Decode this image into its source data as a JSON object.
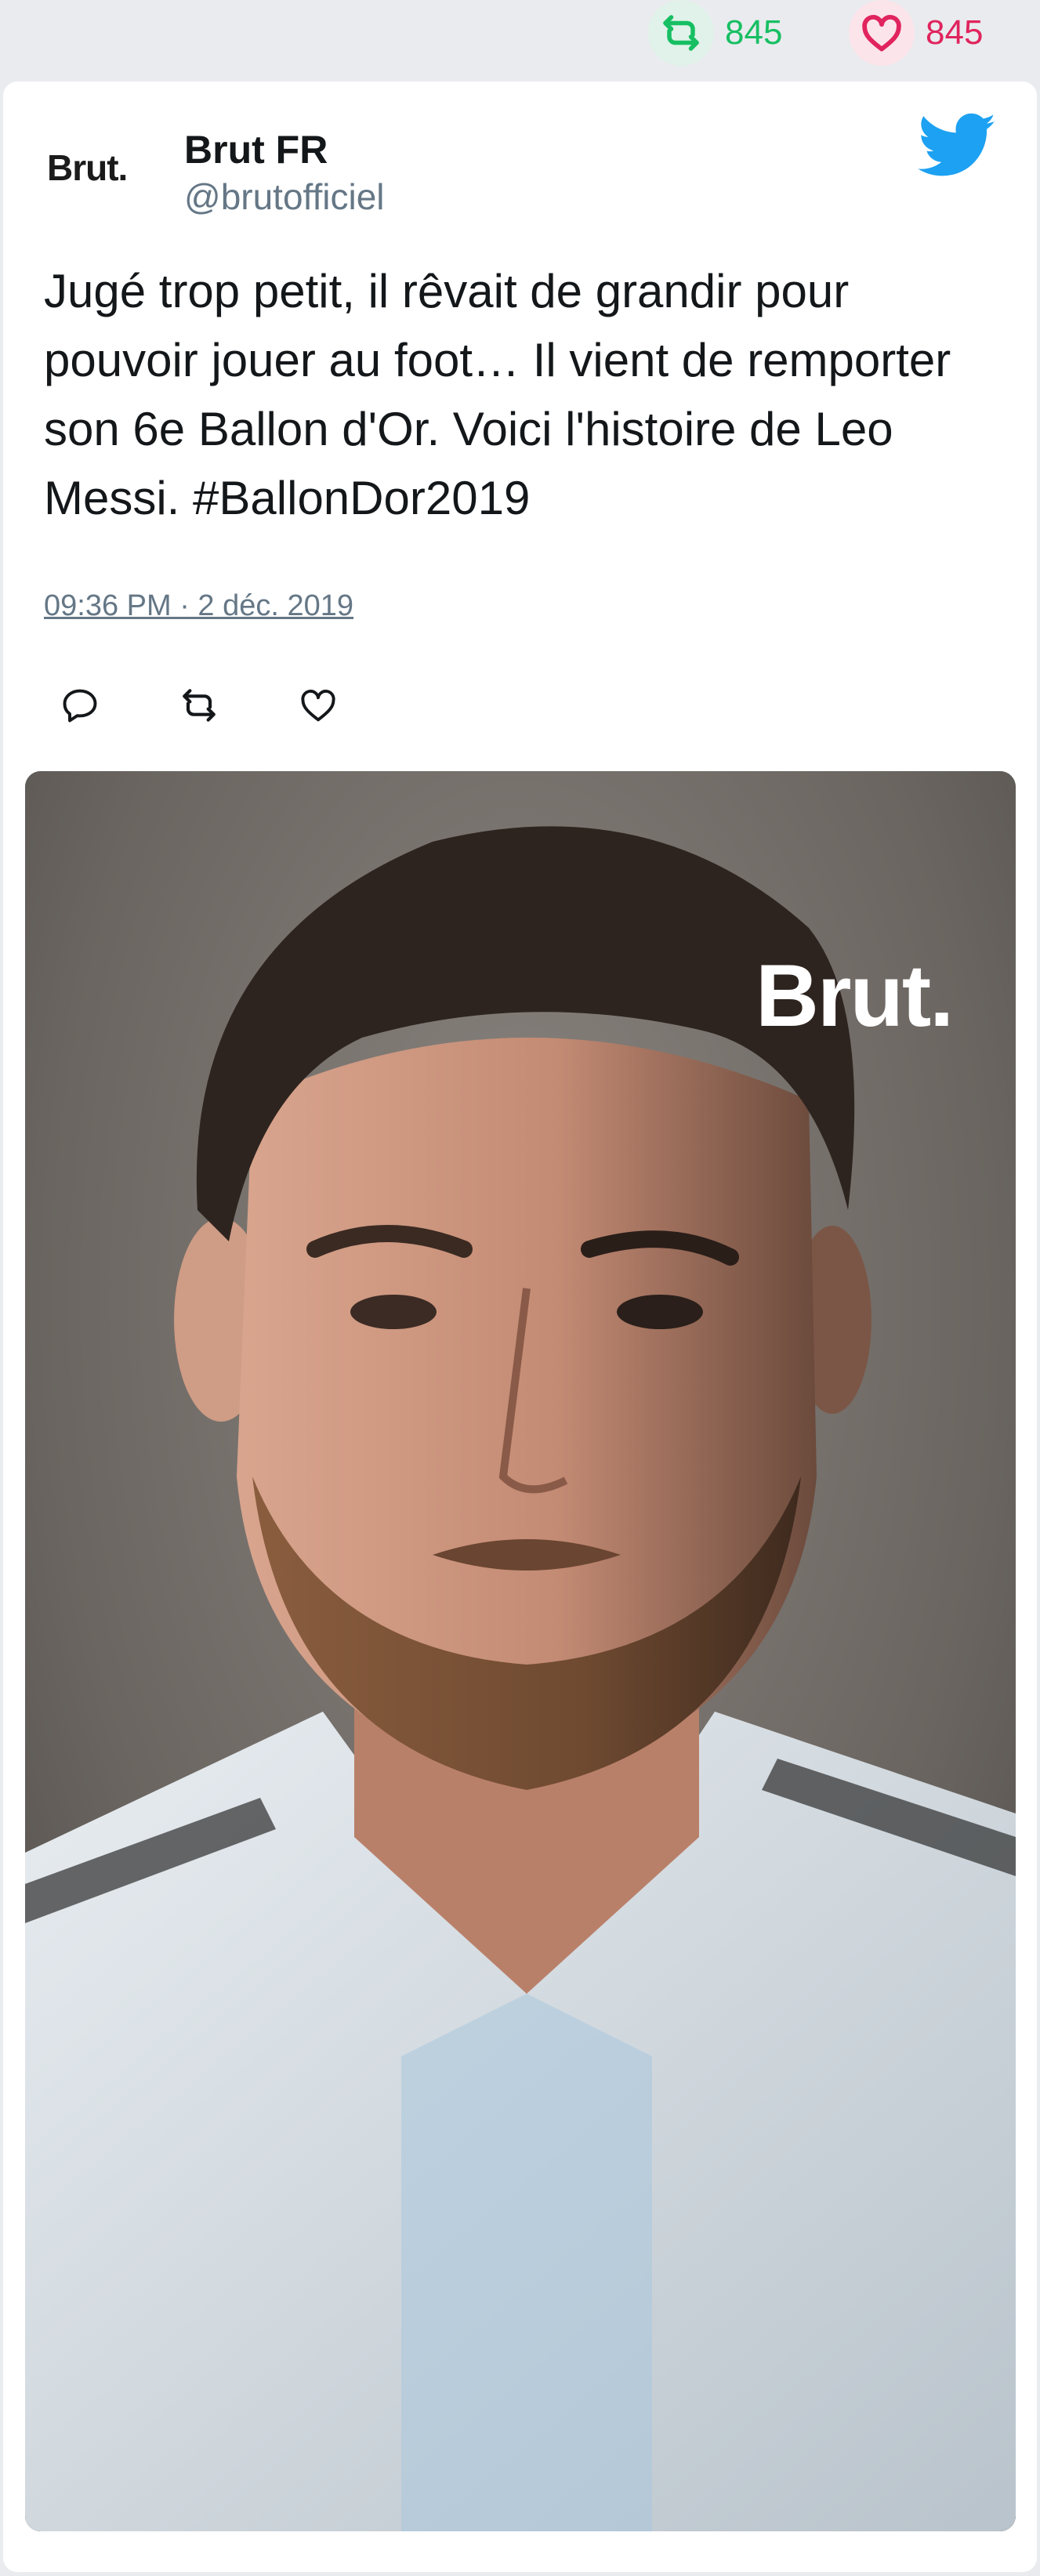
{
  "stats": {
    "retweet_count": "845",
    "like_count": "845"
  },
  "tweet": {
    "avatar_text": "Brut.",
    "display_name": "Brut FR",
    "handle": "@brutofficiel",
    "text": "Jugé trop petit, il rêvait de grandir pour pouvoir jouer au foot… Il vient de remporter son 6e Ballon d'Or. Voici l'histoire de Leo Messi. #BallonDor2019",
    "timestamp": "09:36 PM · 2 déc. 2019"
  },
  "media": {
    "watermark": "Brut."
  },
  "colors": {
    "retweet_green": "#17bf63",
    "like_red": "#e0245e",
    "twitter_blue": "#1da1f2",
    "muted": "#657786"
  },
  "icons": {
    "stats_retweet": "retweet-icon",
    "stats_like": "heart-icon",
    "brand": "twitter-bird-icon",
    "reply": "reply-icon",
    "retweet": "retweet-icon",
    "like": "heart-icon"
  }
}
